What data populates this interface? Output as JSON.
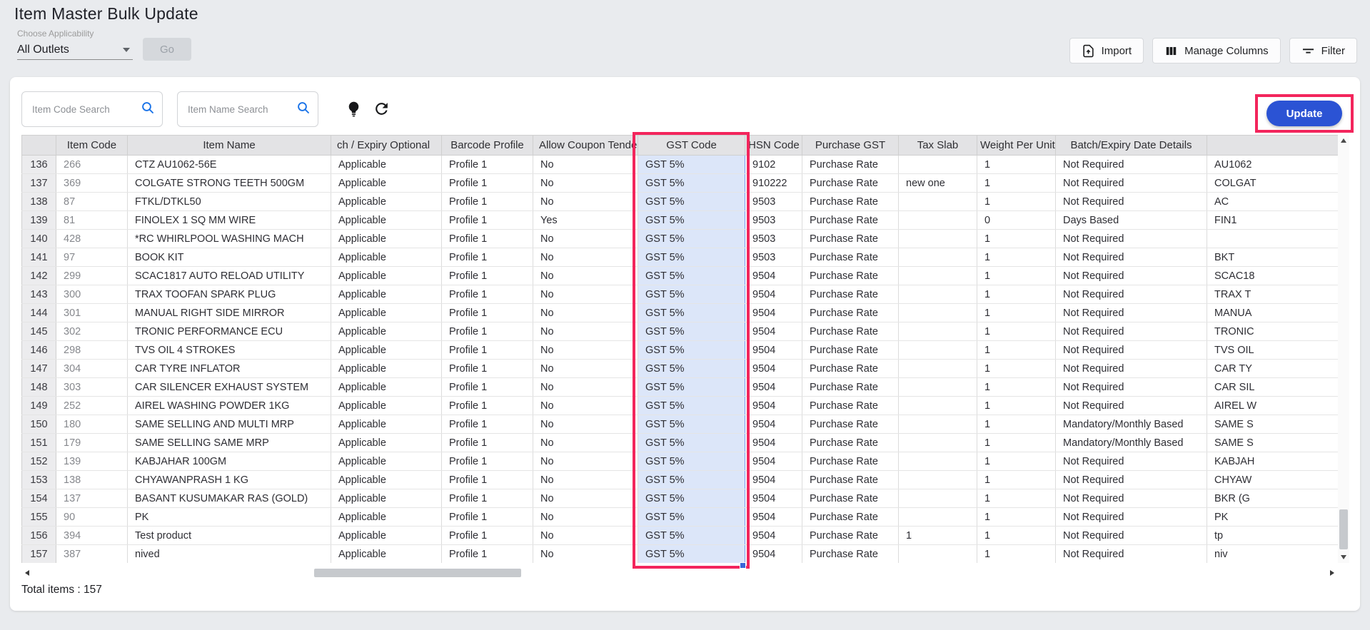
{
  "header": {
    "title": "Item Master Bulk Update",
    "applicability_label": "Choose Applicability",
    "applicability_value": "All Outlets",
    "go_label": "Go",
    "import_label": "Import",
    "manage_columns_label": "Manage Columns",
    "filter_label": "Filter"
  },
  "toolbar": {
    "item_code_placeholder": "Item Code Search",
    "item_name_placeholder": "Item Name Search",
    "update_label": "Update"
  },
  "table": {
    "highlighted_column": "GST Code",
    "columns": [
      {
        "key": "row-number",
        "label": ""
      },
      {
        "key": "item-code",
        "label": "Item Code"
      },
      {
        "key": "item-name",
        "label": "Item Name"
      },
      {
        "key": "batch-expiry-optional",
        "label": "ch / Expiry Optional"
      },
      {
        "key": "barcode-profile",
        "label": "Barcode Profile"
      },
      {
        "key": "allow-coupon-tender",
        "label": "Allow Coupon Tende"
      },
      {
        "key": "gst-code",
        "label": "GST Code"
      },
      {
        "key": "hsn-code",
        "label": "HSN Code"
      },
      {
        "key": "purchase-gst",
        "label": "Purchase GST"
      },
      {
        "key": "tax-slab",
        "label": "Tax Slab"
      },
      {
        "key": "weight-per-unit",
        "label": "Weight Per Unit"
      },
      {
        "key": "batch-expiry-date-details",
        "label": "Batch/Expiry Date Details"
      },
      {
        "key": "extra",
        "label": ""
      }
    ],
    "rows": [
      [
        "136",
        "266",
        "CTZ AU1062-56E",
        "Applicable",
        "Profile 1",
        "No",
        "GST 5%",
        "9102",
        "Purchase Rate",
        "",
        "1",
        "Not Required",
        "AU1062"
      ],
      [
        "137",
        "369",
        "COLGATE STRONG TEETH 500GM",
        "Applicable",
        "Profile 1",
        "No",
        "GST 5%",
        "910222",
        "Purchase Rate",
        "new one",
        "1",
        "Not Required",
        "COLGAT"
      ],
      [
        "138",
        "87",
        "FTKL/DTKL50",
        "Applicable",
        "Profile 1",
        "No",
        "GST 5%",
        "9503",
        "Purchase Rate",
        "",
        "1",
        "Not Required",
        "AC"
      ],
      [
        "139",
        "81",
        "FINOLEX 1 SQ MM WIRE",
        "Applicable",
        "Profile 1",
        "Yes",
        "GST 5%",
        "9503",
        "Purchase Rate",
        "",
        "0",
        "Days Based",
        "FIN1"
      ],
      [
        "140",
        "428",
        "*RC WHIRLPOOL WASHING MACH",
        "Applicable",
        "Profile 1",
        "No",
        "GST 5%",
        "9503",
        "Purchase Rate",
        "",
        "1",
        "Not Required",
        ""
      ],
      [
        "141",
        "97",
        "BOOK KIT",
        "Applicable",
        "Profile 1",
        "No",
        "GST 5%",
        "9503",
        "Purchase Rate",
        "",
        "1",
        "Not Required",
        "BKT"
      ],
      [
        "142",
        "299",
        "SCAC1817 AUTO RELOAD UTILITY",
        "Applicable",
        "Profile 1",
        "No",
        "GST 5%",
        "9504",
        "Purchase Rate",
        "",
        "1",
        "Not Required",
        "SCAC18"
      ],
      [
        "143",
        "300",
        "TRAX TOOFAN SPARK PLUG",
        "Applicable",
        "Profile 1",
        "No",
        "GST 5%",
        "9504",
        "Purchase Rate",
        "",
        "1",
        "Not Required",
        "TRAX T"
      ],
      [
        "144",
        "301",
        "MANUAL RIGHT SIDE MIRROR",
        "Applicable",
        "Profile 1",
        "No",
        "GST 5%",
        "9504",
        "Purchase Rate",
        "",
        "1",
        "Not Required",
        "MANUA"
      ],
      [
        "145",
        "302",
        "TRONIC PERFORMANCE ECU",
        "Applicable",
        "Profile 1",
        "No",
        "GST 5%",
        "9504",
        "Purchase Rate",
        "",
        "1",
        "Not Required",
        "TRONIC"
      ],
      [
        "146",
        "298",
        "TVS OIL 4 STROKES",
        "Applicable",
        "Profile 1",
        "No",
        "GST 5%",
        "9504",
        "Purchase Rate",
        "",
        "1",
        "Not Required",
        "TVS OIL"
      ],
      [
        "147",
        "304",
        "CAR TYRE INFLATOR",
        "Applicable",
        "Profile 1",
        "No",
        "GST 5%",
        "9504",
        "Purchase Rate",
        "",
        "1",
        "Not Required",
        "CAR TY"
      ],
      [
        "148",
        "303",
        "CAR SILENCER EXHAUST SYSTEM",
        "Applicable",
        "Profile 1",
        "No",
        "GST 5%",
        "9504",
        "Purchase Rate",
        "",
        "1",
        "Not Required",
        "CAR SIL"
      ],
      [
        "149",
        "252",
        "AIREL WASHING POWDER 1KG",
        "Applicable",
        "Profile 1",
        "No",
        "GST 5%",
        "9504",
        "Purchase Rate",
        "",
        "1",
        "Not Required",
        "AIREL W"
      ],
      [
        "150",
        "180",
        "SAME SELLING AND MULTI MRP",
        "Applicable",
        "Profile 1",
        "No",
        "GST 5%",
        "9504",
        "Purchase Rate",
        "",
        "1",
        "Mandatory/Monthly Based",
        "SAME S"
      ],
      [
        "151",
        "179",
        "SAME SELLING SAME MRP",
        "Applicable",
        "Profile 1",
        "No",
        "GST 5%",
        "9504",
        "Purchase Rate",
        "",
        "1",
        "Mandatory/Monthly Based",
        "SAME S"
      ],
      [
        "152",
        "139",
        "KABJAHAR 100GM",
        "Applicable",
        "Profile 1",
        "No",
        "GST 5%",
        "9504",
        "Purchase Rate",
        "",
        "1",
        "Not Required",
        "KABJAH"
      ],
      [
        "153",
        "138",
        "CHYAWANPRASH 1 KG",
        "Applicable",
        "Profile 1",
        "No",
        "GST 5%",
        "9504",
        "Purchase Rate",
        "",
        "1",
        "Not Required",
        "CHYAW"
      ],
      [
        "154",
        "137",
        "BASANT KUSUMAKAR RAS (GOLD)",
        "Applicable",
        "Profile 1",
        "No",
        "GST 5%",
        "9504",
        "Purchase Rate",
        "",
        "1",
        "Not Required",
        "BKR (G"
      ],
      [
        "155",
        "90",
        "PK",
        "Applicable",
        "Profile 1",
        "No",
        "GST 5%",
        "9504",
        "Purchase Rate",
        "",
        "1",
        "Not Required",
        "PK"
      ],
      [
        "156",
        "394",
        "Test product",
        "Applicable",
        "Profile 1",
        "No",
        "GST 5%",
        "9504",
        "Purchase Rate",
        "1",
        "1",
        "Not Required",
        "tp"
      ],
      [
        "157",
        "387",
        "nived",
        "Applicable",
        "Profile 1",
        "No",
        "GST 5%",
        "9504",
        "Purchase Rate",
        "",
        "1",
        "Not Required",
        "niv"
      ]
    ]
  },
  "footer": {
    "total_label": "Total items : 157"
  },
  "colors": {
    "accent_blue": "#2B53D4",
    "highlight_pink": "#F3255C",
    "selection_bg": "#DCE6F9",
    "selection_border": "#7B9CEA"
  }
}
